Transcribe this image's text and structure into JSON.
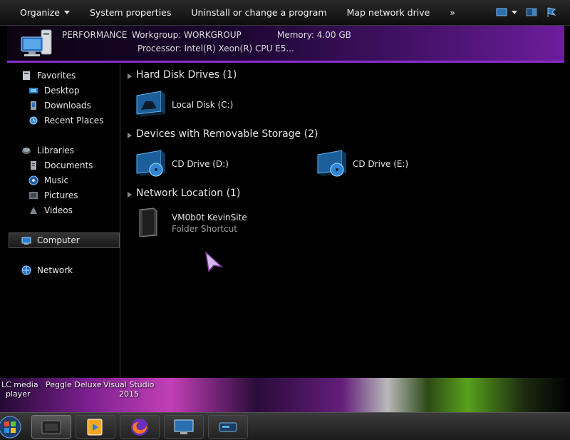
{
  "toolbar": {
    "organize": "Organize",
    "system_properties": "System properties",
    "uninstall": "Uninstall or change a program",
    "map_drive": "Map network drive",
    "more": "»"
  },
  "details": {
    "name": "PERFORMANCE",
    "workgroup": "Workgroup: WORKGROUP",
    "memory": "Memory: 4.00 GB",
    "processor": "Processor: Intel(R) Xeon(R) CPU E5..."
  },
  "nav": {
    "favorites": "Favorites",
    "desktop": "Desktop",
    "downloads": "Downloads",
    "recent": "Recent Places",
    "libraries": "Libraries",
    "documents": "Documents",
    "music": "Music",
    "pictures": "Pictures",
    "videos": "Videos",
    "computer": "Computer",
    "network": "Network"
  },
  "groups": {
    "hdd": "Hard Disk Drives (1)",
    "removable": "Devices with Removable Storage (2)",
    "network": "Network Location (1)"
  },
  "items": {
    "local_disk": "Local Disk (C:)",
    "cd_d": "CD Drive (D:)",
    "cd_e": "CD Drive (E:)",
    "net_name": "VM0b0t KevinSite",
    "net_type": "Folder Shortcut"
  },
  "desktop": {
    "vlc_line1": "LC media",
    "vlc_line2": "player",
    "peggle": "Peggle Deluxe",
    "vs_line1": "Visual Studio",
    "vs_line2": "2015"
  },
  "icons": {
    "start": "windows-start-icon",
    "explorer": "explorer-icon",
    "media": "media-player-icon",
    "firefox": "firefox-icon",
    "monitor": "monitor-icon",
    "drive": "drive-icon"
  },
  "colors": {
    "accent": "#8a2ec8",
    "drive_blue": "#2a8fd8"
  }
}
